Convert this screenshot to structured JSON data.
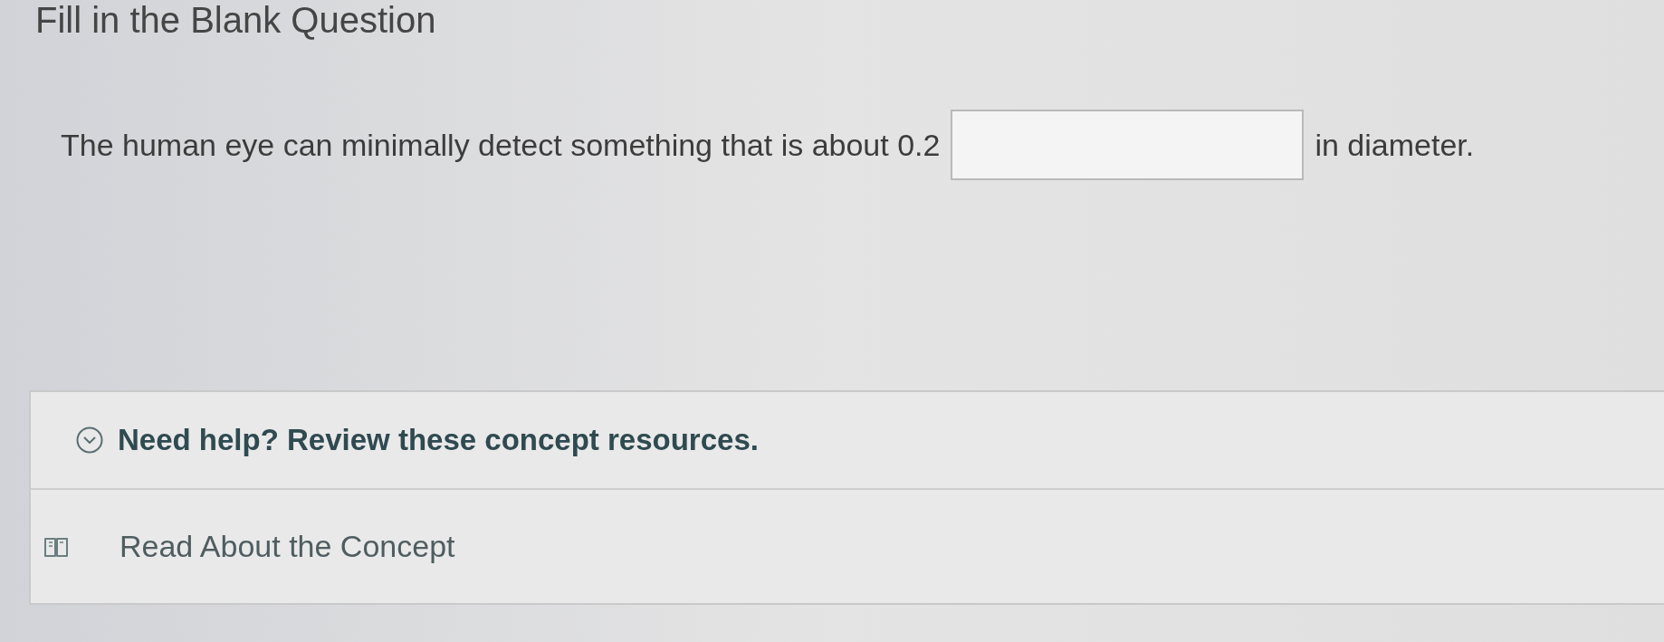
{
  "title": "Fill in the Blank Question",
  "question": {
    "segments": [
      {
        "kind": "text",
        "text": "The human eye can minimally detect something that is about 0.2"
      },
      {
        "kind": "blank"
      },
      {
        "kind": "text",
        "text": "in diameter."
      }
    ]
  },
  "help": {
    "heading": "Need help? Review these concept resources.",
    "resources": [
      {
        "kind": "read",
        "label": "Read About the Concept"
      }
    ]
  }
}
